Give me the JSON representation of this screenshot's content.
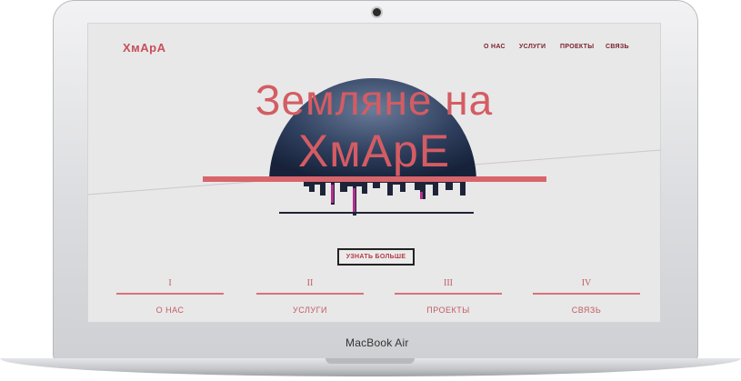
{
  "device": {
    "model_label": "MacBook Air"
  },
  "site": {
    "logo": "ХмАрА",
    "nav": [
      "О НАС",
      "УСЛУГИ",
      "ПРОЕКТЫ",
      "СВЯЗЬ"
    ],
    "hero": {
      "line1": "Земляне на",
      "line2": "ХмАрЕ"
    },
    "cta_label": "УЗНАТЬ БОЛЬШЕ",
    "sections": [
      {
        "numeral": "I",
        "label": "О НАС"
      },
      {
        "numeral": "II",
        "label": "УСЛУГИ"
      },
      {
        "numeral": "III",
        "label": "ПРОЕКТЫ"
      },
      {
        "numeral": "IV",
        "label": "СВЯЗЬ"
      }
    ],
    "colors": {
      "accent": "#d45c63",
      "dark_accent": "#7a1e2b",
      "background": "#e8e8e8"
    }
  }
}
